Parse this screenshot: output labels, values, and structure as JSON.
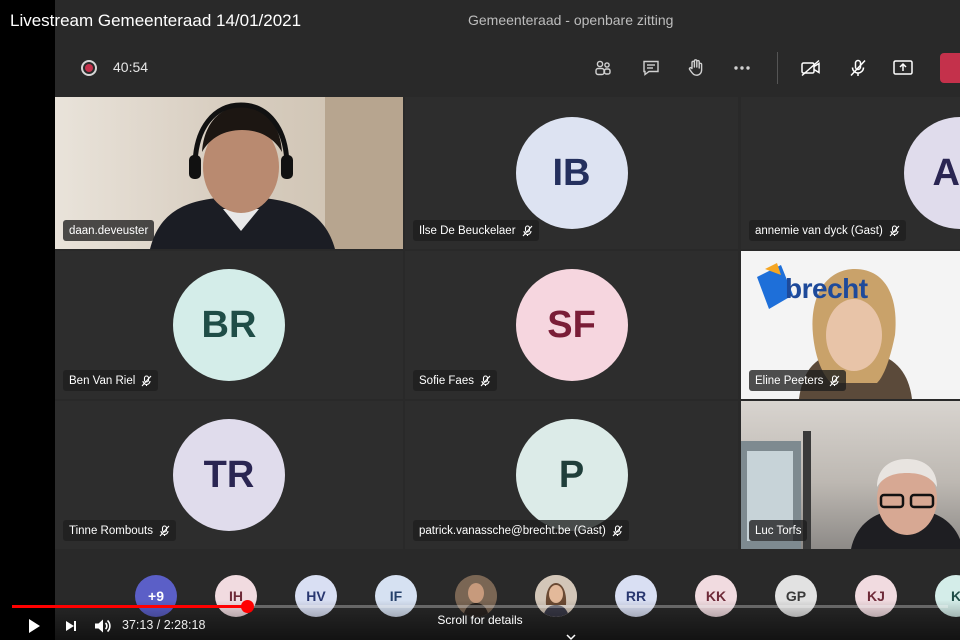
{
  "video": {
    "title": "Livestream Gemeenteraad 14/01/2021",
    "current_time": "37:13",
    "duration": "2:28:18",
    "time_separator": " / ",
    "progress": 0.251,
    "scroll_hint": "Scroll for details"
  },
  "meeting": {
    "title": "Gemeenteraad - openbare zitting",
    "elapsed": "40:54"
  },
  "colors": {
    "record": "#c4314b",
    "leave": "#c4314b",
    "progress": "#ff0000"
  },
  "tiles": [
    {
      "name": "daan.deveuster",
      "muted": false,
      "video": true
    },
    {
      "name": "Ilse De Beuckelaer",
      "initials": "IB",
      "muted": true,
      "bg": "#dde3f2",
      "fg": "#24305e"
    },
    {
      "name": "annemie van dyck (Gast)",
      "initials": "AD",
      "muted": true,
      "bg": "#e0dcec",
      "fg": "#2a2552"
    },
    {
      "name": "Ben Van Riel",
      "initials": "BR",
      "muted": true,
      "bg": "#d4ede9",
      "fg": "#1f4d47"
    },
    {
      "name": "Sofie Faes",
      "initials": "SF",
      "muted": true,
      "bg": "#f6d6df",
      "fg": "#7a1d37"
    },
    {
      "name": "Eline Peeters",
      "muted": true,
      "video": true,
      "logo_text": "brecht"
    },
    {
      "name": "Tinne Rombouts",
      "initials": "TR",
      "muted": true,
      "bg": "#e0dcec",
      "fg": "#2a2552"
    },
    {
      "name": "patrick.vanassche@brecht.be (Gast)",
      "initials": "P",
      "muted": true,
      "bg": "#dcebe8",
      "fg": "#1f3e3a"
    },
    {
      "name": "Luc Torfs",
      "muted": false,
      "video": true
    }
  ],
  "strip": [
    {
      "label": "+9",
      "bg": "#5b5fc7",
      "fg": "#ffffff"
    },
    {
      "label": "IH",
      "bg": "#f1dbe0",
      "fg": "#6e2a38"
    },
    {
      "label": "HV",
      "bg": "#d9dff3",
      "fg": "#293770"
    },
    {
      "label": "IF",
      "bg": "#d6e1f2",
      "fg": "#25406a"
    },
    {
      "label": "",
      "photo": true,
      "bg": "#6d5a4a"
    },
    {
      "label": "",
      "photo": true,
      "bg": "#c9b9a8"
    },
    {
      "label": "RR",
      "bg": "#d9dff3",
      "fg": "#293770"
    },
    {
      "label": "KK",
      "bg": "#f1dbe0",
      "fg": "#6e2a38"
    },
    {
      "label": "GP",
      "bg": "#e2e2e2",
      "fg": "#3a3a3a"
    },
    {
      "label": "KJ",
      "bg": "#f1dbe0",
      "fg": "#6e2a38"
    },
    {
      "label": "K",
      "bg": "#d4ede9",
      "fg": "#1f4d47"
    }
  ]
}
